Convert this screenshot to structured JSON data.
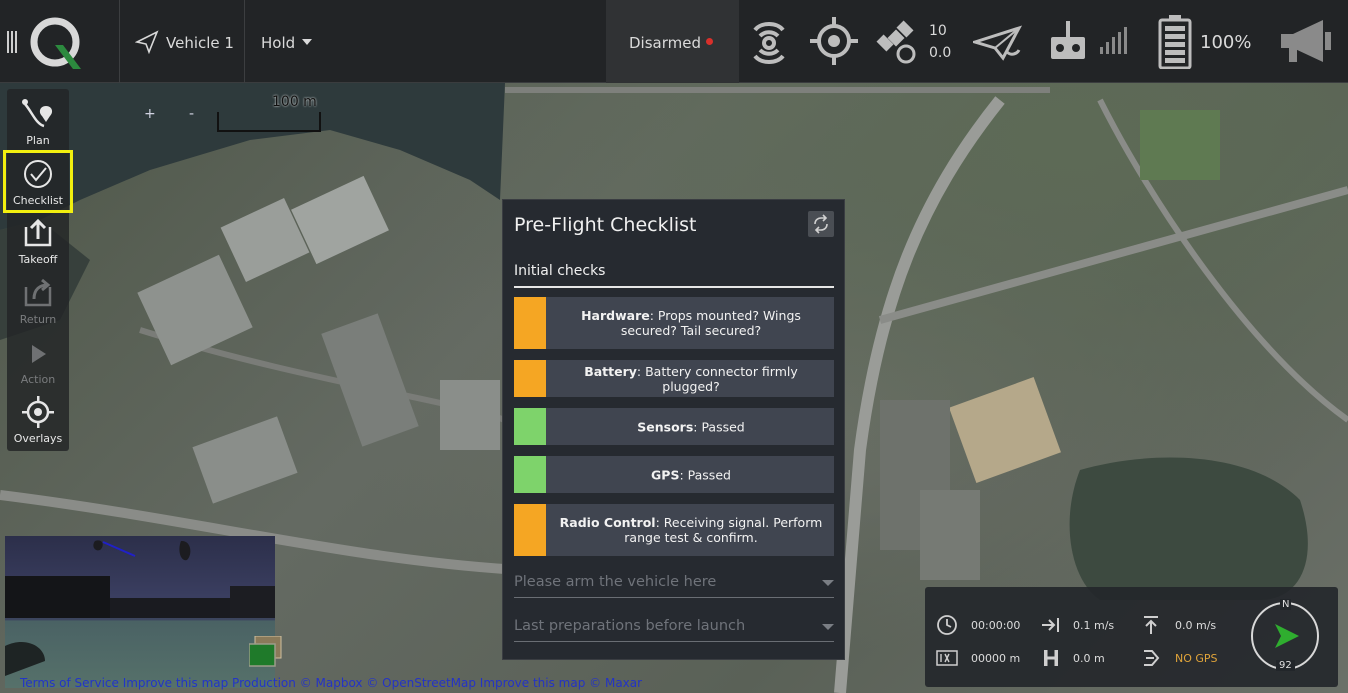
{
  "toolbar": {
    "vehicle_label": "Vehicle 1",
    "mode_label": "Hold",
    "arm_status": "Disarmed",
    "arm_status_color": "#d9302b",
    "gps_count": "10",
    "gps_hdop": "0.0",
    "battery_percent": "100%",
    "icons": [
      "menu-icon",
      "qgc-logo",
      "paper-plane-icon",
      "rc-signal-icon",
      "target-icon",
      "satellite-icon",
      "telemetry-icon",
      "joystick-icon",
      "signal-bars-icon",
      "battery-icon",
      "megaphone-icon"
    ]
  },
  "tools": [
    {
      "label": "Plan",
      "icon": "plan-icon",
      "enabled": true
    },
    {
      "label": "Checklist",
      "icon": "checklist-icon",
      "enabled": true,
      "highlighted": true
    },
    {
      "label": "Takeoff",
      "icon": "takeoff-icon",
      "enabled": true
    },
    {
      "label": "Return",
      "icon": "return-icon",
      "enabled": false
    },
    {
      "label": "Action",
      "icon": "play-icon",
      "enabled": false
    },
    {
      "label": "Overlays",
      "icon": "crosshair-icon",
      "enabled": true
    }
  ],
  "map": {
    "zoom_in": "+",
    "zoom_out": "-",
    "scale": "100 m",
    "attribution": "Terms of Service    Improve this map    Production    © Mapbox © OpenStreetMap Improve this map © Maxar"
  },
  "checklist": {
    "title": "Pre-Flight Checklist",
    "group": "Initial checks",
    "items": [
      {
        "name": "Hardware",
        "text": ": Props mounted? Wings secured? Tail secured?",
        "status_color": "#f5a623"
      },
      {
        "name": "Battery",
        "text": ": Battery connector firmly plugged?",
        "status_color": "#f5a623"
      },
      {
        "name": "Sensors",
        "text": ": Passed",
        "status_color": "#7ed36b"
      },
      {
        "name": "GPS",
        "text": ": Passed",
        "status_color": "#7ed36b"
      },
      {
        "name": "Radio Control",
        "text": ": Receiving signal. Perform range test & confirm.",
        "status_color": "#f5a623"
      }
    ],
    "collapsed_groups": [
      "Please arm the vehicle here",
      "Last preparations before launch"
    ]
  },
  "telemetry": {
    "flight_time": "00:00:00",
    "ground_speed": "0.1 m/s",
    "climb_rate": "0.0 m/s",
    "distance": "00000 m",
    "height": "0.0 m",
    "gps_status": "NO GPS",
    "gps_status_color": "#e0a43a",
    "compass_north": "N",
    "heading": "92"
  }
}
